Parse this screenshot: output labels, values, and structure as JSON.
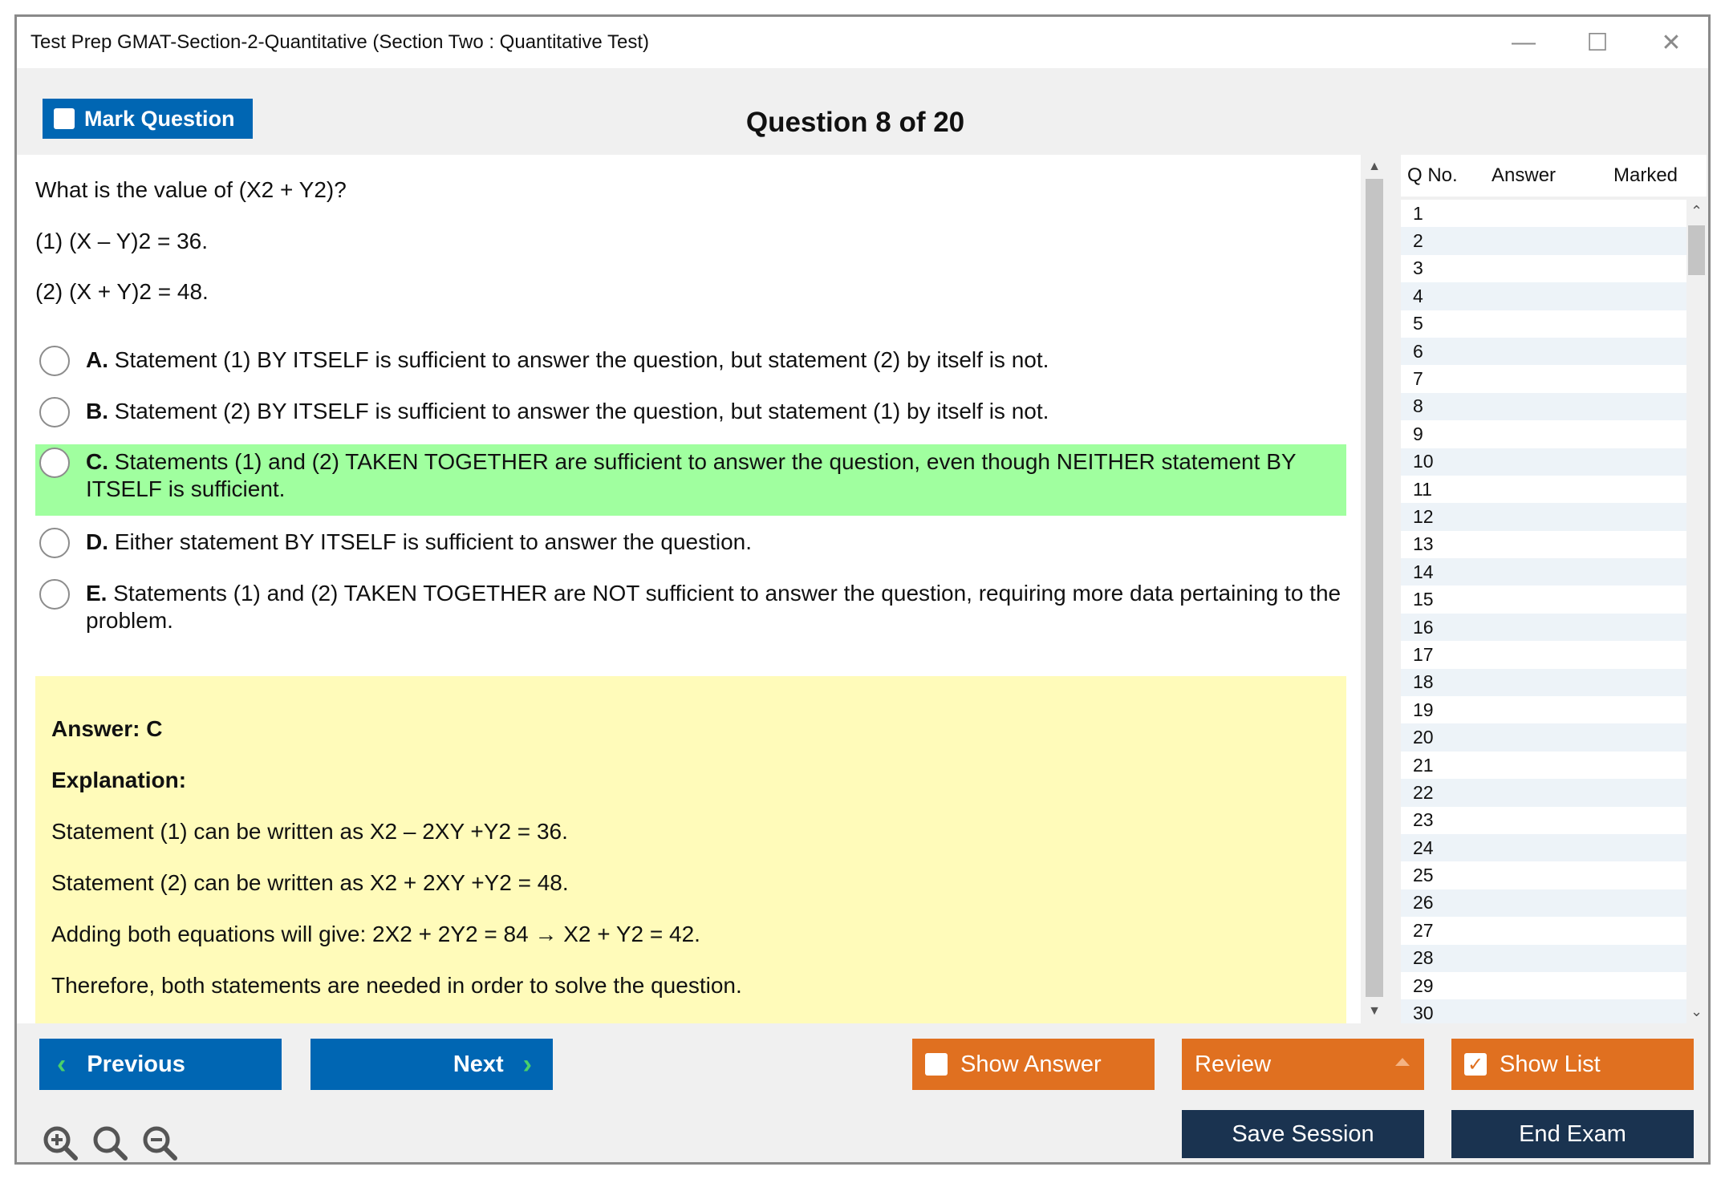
{
  "window": {
    "title": "Test Prep GMAT-Section-2-Quantitative (Section Two : Quantitative Test)",
    "minimize_glyph": "—",
    "maximize_glyph": "☐",
    "close_glyph": "✕"
  },
  "header": {
    "mark_question_label": "Mark Question",
    "question_counter": "Question 8 of 20"
  },
  "question": {
    "stem": "What is the value of (X2 + Y2)?",
    "statement1": "(1) (X – Y)2 = 36.",
    "statement2": "(2) (X + Y)2 = 48."
  },
  "options": [
    {
      "letter": "A.",
      "text": " Statement (1) BY ITSELF is sufficient to answer the question, but statement (2) by itself is not.",
      "highlighted": false
    },
    {
      "letter": "B.",
      "text": " Statement (2) BY ITSELF is sufficient to answer the question, but statement (1) by itself is not.",
      "highlighted": false
    },
    {
      "letter": "C.",
      "text": " Statements (1) and (2) TAKEN TOGETHER are sufficient to answer the question, even though NEITHER statement BY ITSELF is sufficient.",
      "highlighted": true
    },
    {
      "letter": "D.",
      "text": " Either statement BY ITSELF is sufficient to answer the question.",
      "highlighted": false
    },
    {
      "letter": "E.",
      "text": " Statements (1) and (2) TAKEN TOGETHER are NOT sufficient to answer the question, requiring more data pertaining to the problem.",
      "highlighted": false
    }
  ],
  "answer": {
    "answer_line": "Answer: C",
    "explanation_heading": "Explanation:",
    "lines": [
      "Statement (1) can be written as X2 – 2XY +Y2 = 36.",
      "Statement (2) can be written as X2 + 2XY +Y2 = 48.",
      "Adding both equations will give: 2X2 + 2Y2 = 84 → X2 + Y2 = 42.",
      "Therefore, both statements are needed in order to solve the question."
    ]
  },
  "question_list": {
    "headers": {
      "qno": "Q No.",
      "answer": "Answer",
      "marked": "Marked"
    },
    "rows": [
      "1",
      "2",
      "3",
      "4",
      "5",
      "6",
      "7",
      "8",
      "9",
      "10",
      "11",
      "12",
      "13",
      "14",
      "15",
      "16",
      "17",
      "18",
      "19",
      "20",
      "21",
      "22",
      "23",
      "24",
      "25",
      "26",
      "27",
      "28",
      "29",
      "30"
    ]
  },
  "footer": {
    "previous_label": "Previous",
    "next_label": "Next",
    "show_answer_label": "Show Answer",
    "review_label": "Review",
    "show_list_label": "Show List",
    "save_session_label": "Save Session",
    "end_exam_label": "End Exam"
  },
  "colors": {
    "accent_blue": "#0066b3",
    "accent_orange": "#e07020",
    "navy": "#1a3350",
    "correct_highlight": "#a0ff9f",
    "answer_bg": "#fffbba",
    "chevron_green": "#4ad06a"
  },
  "icons": {
    "zoom_in": "zoom-in-icon",
    "zoom_reset": "zoom-reset-icon",
    "zoom_out": "zoom-out-icon"
  }
}
